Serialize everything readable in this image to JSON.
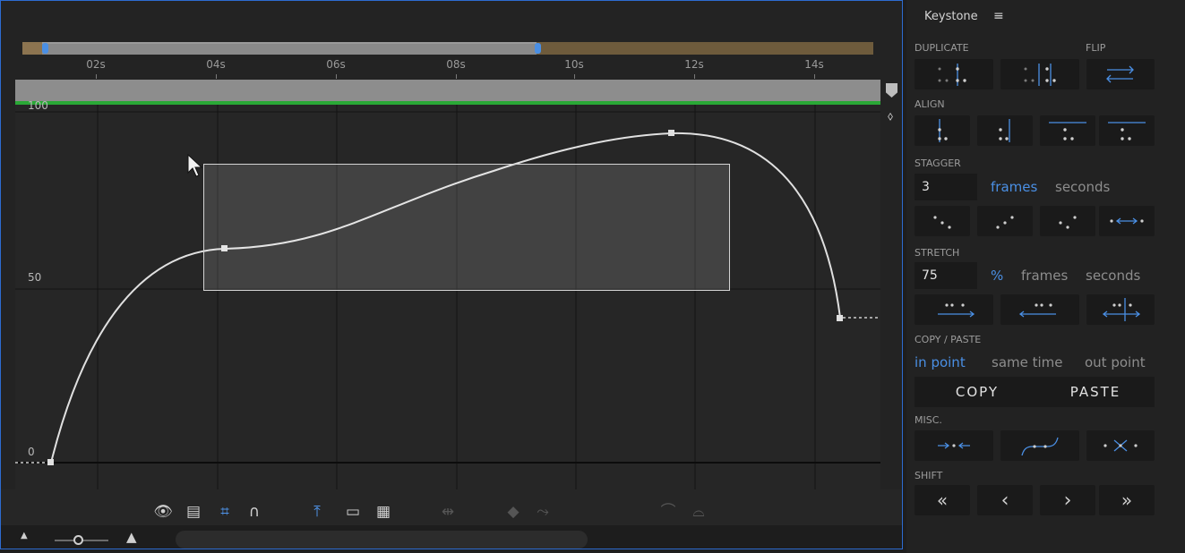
{
  "graph_editor": {
    "time_ruler": [
      "02s",
      "04s",
      "06s",
      "08s",
      "10s",
      "12s",
      "14s"
    ],
    "y_labels": [
      "100",
      "50",
      "0"
    ],
    "keyframe_values": {
      "x_seconds": [
        0.0,
        4.1,
        11.7,
        14.6
      ],
      "y_values": [
        0,
        60,
        95,
        42
      ]
    },
    "toolbar_icons": [
      "eye-icon",
      "properties-list-icon",
      "transform-box-icon",
      "snap-magnet-icon",
      "fit-to-view-icon",
      "fit-all-icon",
      "show-reference-graph-icon",
      "separate-dimensions-icon",
      "keyframe-edit-icon",
      "convert-keyframe-icon",
      "easy-ease-icon",
      "easy-ease-in-icon"
    ],
    "colors": {
      "panel_border": "#2d6bd0",
      "green_line": "#2aa836",
      "accent_blue": "#4a8fe4",
      "work_area": "#6e5b3c"
    }
  },
  "keystone": {
    "title": "Keystone",
    "menu_icon": "hamburger-menu-icon",
    "sections": {
      "duplicate": "DUPLICATE",
      "flip": "FLIP",
      "align": "ALIGN",
      "stagger": "STAGGER",
      "stretch": "STRETCH",
      "copy_paste": "COPY / PASTE",
      "misc": "MISC.",
      "shift": "SHIFT"
    },
    "stagger": {
      "value": "3",
      "unit_frames": "frames",
      "unit_seconds": "seconds",
      "active": "frames"
    },
    "stretch": {
      "value": "75",
      "unit_percent": "%",
      "unit_frames": "frames",
      "unit_seconds": "seconds",
      "active": "%"
    },
    "copy_paste": {
      "in_point": "in point",
      "same_time": "same time",
      "out_point": "out point",
      "active": "in point",
      "copy_label": "COPY",
      "paste_label": "PASTE"
    },
    "shift": {
      "first": "«",
      "prev": "‹",
      "next": "›",
      "last": "»"
    }
  }
}
